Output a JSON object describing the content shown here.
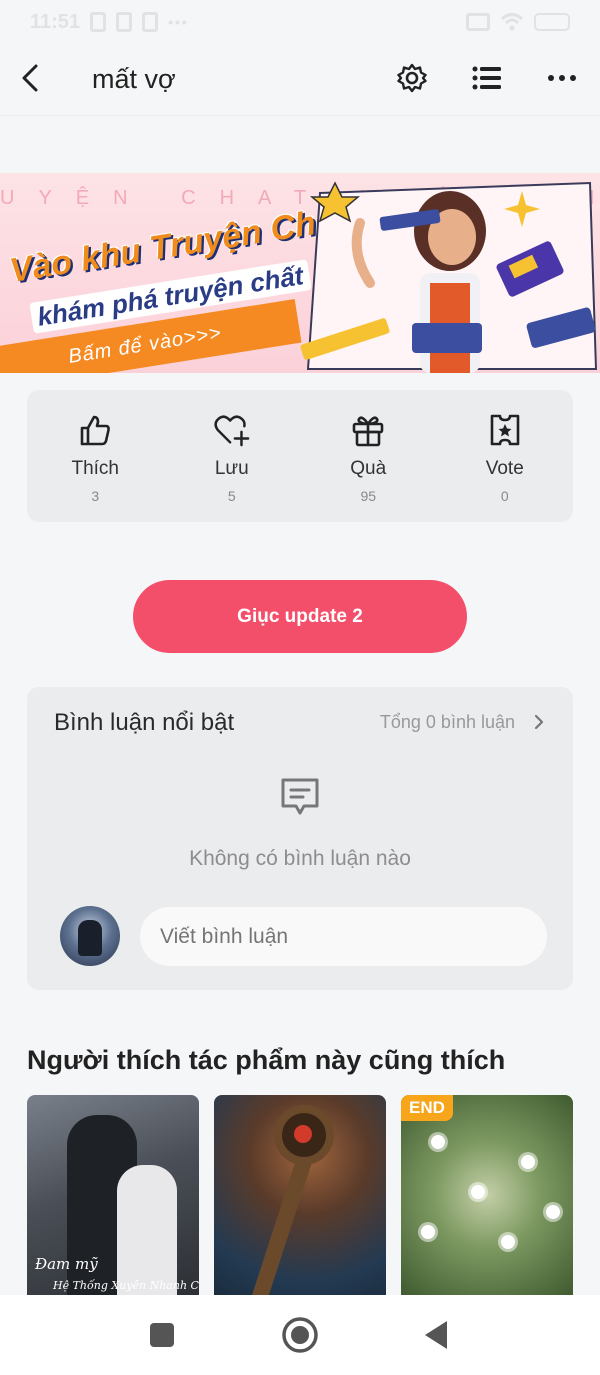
{
  "status_bar": {
    "time": "11:51"
  },
  "header": {
    "title": "mất vợ"
  },
  "banner": {
    "bg_text": "UYỆN CHAT  KHÁM PHÁ",
    "line1": "Vào khu Truyện Chat,",
    "line2": "khám phá truyện chất",
    "cta": "Bấm để vào>>>"
  },
  "stats": [
    {
      "label": "Thích",
      "count": "3",
      "icon": "thumbs-up-icon"
    },
    {
      "label": "Lưu",
      "count": "5",
      "icon": "heart-plus-icon"
    },
    {
      "label": "Quà",
      "count": "95",
      "icon": "gift-icon"
    },
    {
      "label": "Vote",
      "count": "0",
      "icon": "vote-ticket-icon"
    }
  ],
  "urge_button": {
    "label": "Giục update 2"
  },
  "comments": {
    "title": "Bình luận nổi bật",
    "total": "Tổng 0 bình luận",
    "empty_text": "Không có bình luận nào",
    "input_placeholder": "Viết bình luận"
  },
  "recommendations": {
    "title": "Người thích tác phẩm này cũng thích",
    "cards": [
      {
        "cover_text": "Đam mỹ",
        "cover_sub": "Hệ Thống Xuyên Nhanh Của"
      },
      {
        "cover_text": ""
      },
      {
        "badge": "END"
      }
    ]
  },
  "colors": {
    "accent": "#f44f6a",
    "background": "#f5f6f8",
    "card": "#ebecee",
    "badge": "#f7a51b"
  }
}
